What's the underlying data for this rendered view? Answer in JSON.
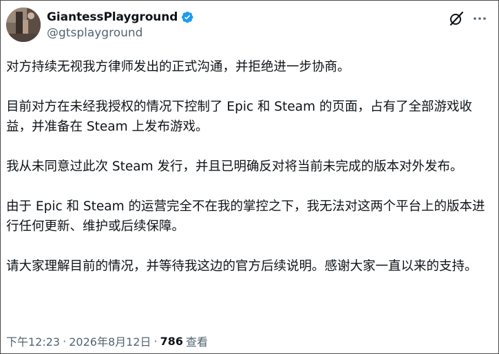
{
  "author": {
    "display_name": "GiantessPlayground",
    "handle": "@gtsplayground",
    "verified_icon": "verified-badge-icon",
    "verified_color": "#1d9bf0"
  },
  "actions": {
    "grok_icon": "grok-icon",
    "more_icon": "more-icon"
  },
  "tweet": {
    "paragraphs": [
      "对方持续无视我方律师发出的正式沟通，并拒绝进一步协商。",
      "目前对方在未经我授权的情况下控制了 Epic 和 Steam 的页面，占有了全部游戏收益，并准备在 Steam 上发布游戏。",
      "我从未同意过此次 Steam 发行，并且已明确反对将当前未完成的版本对外发布。",
      "由于 Epic 和 Steam 的运营完全不在我的掌控之下，我无法对这两个平台上的版本进行任何更新、维护或后续保障。",
      "请大家理解目前的情况，并等待我这边的官方后续说明。感谢大家一直以来的支持。"
    ]
  },
  "meta": {
    "time": "下午12:23",
    "separator": "·",
    "date": "2026年8月12日",
    "views_count": "786",
    "views_label": "查看"
  },
  "colors": {
    "text": "#0f1419",
    "secondary": "#536471",
    "border": "#4a4a4a"
  }
}
